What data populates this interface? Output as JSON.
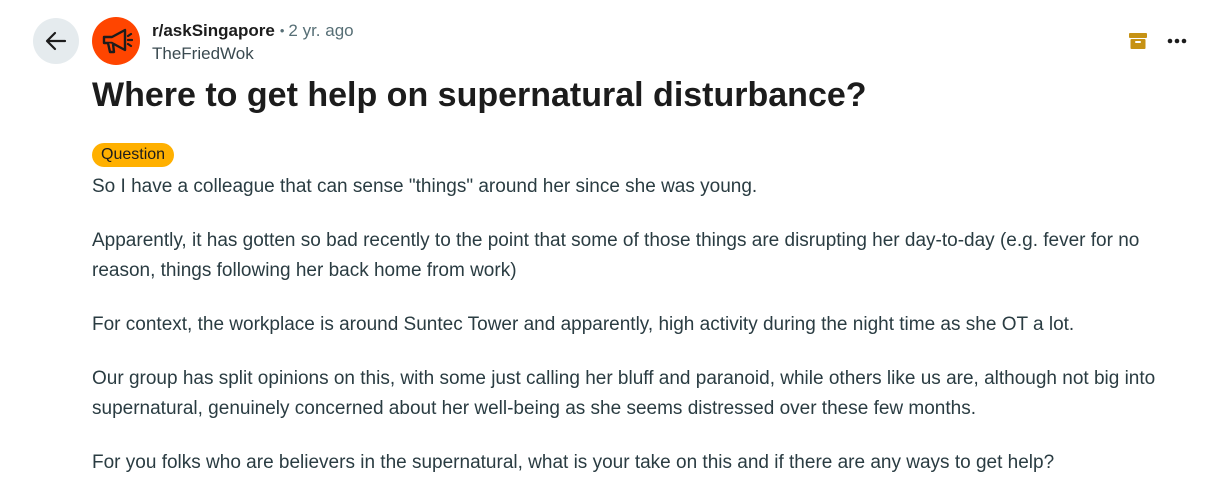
{
  "post": {
    "subreddit": "r/askSingapore",
    "separator": "•",
    "age": "2 yr. ago",
    "author": "TheFriedWok",
    "title": "Where to get help on supernatural disturbance?",
    "flair": "Question",
    "paragraphs": [
      "So I have a colleague that can sense \"things\" around her since she was young.",
      "Apparently, it has gotten so bad recently to the point that some of those things are disrupting her day-to-day (e.g. fever for no reason, things following her back home from work)",
      "For context, the workplace is around Suntec Tower and apparently, high activity during the night time as she OT a lot.",
      "Our group has split opinions on this, with some just calling her bluff and paranoid, while others like us are, although not big into supernatural, genuinely concerned about her well-being as she seems distressed over these few months.",
      "For you folks who are believers in the supernatural, what is your take on this and if there are any ways to get help?"
    ]
  },
  "icons": {
    "back": "arrow-left-icon",
    "avatar": "megaphone-icon",
    "archived": "archive-box-icon",
    "more": "ellipsis-icon"
  },
  "colors": {
    "avatar_bg": "#ff4500",
    "flair_bg": "#ffb000",
    "archive_icon": "#c69214",
    "back_button_bg": "#e5ebee"
  }
}
